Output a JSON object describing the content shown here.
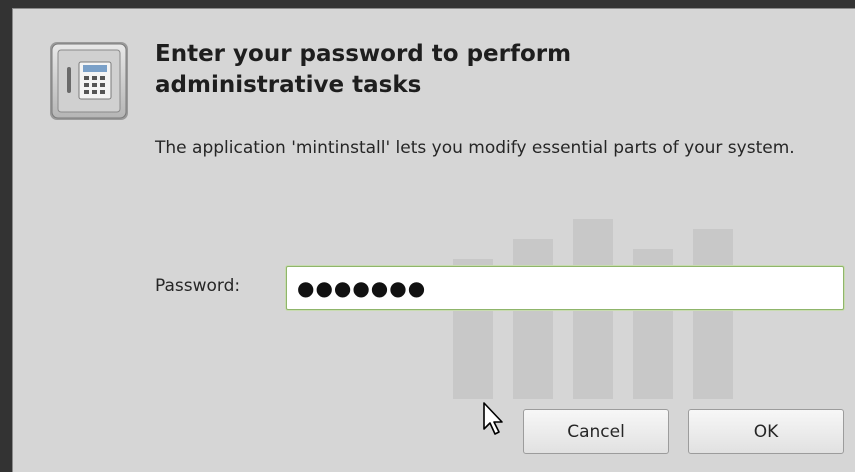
{
  "dialog": {
    "title": "Enter your password to perform administrative tasks",
    "description": "The application 'mintinstall' lets you modify essential parts of your system.",
    "password_label": "Password:",
    "password_value": "●●●●●●●",
    "cancel_label": "Cancel",
    "ok_label": "OK"
  },
  "icons": {
    "app_icon": "safe-keypad-icon",
    "cursor": "mouse-pointer-icon"
  },
  "colors": {
    "dialog_bg": "#d6d6d6",
    "input_focus_border": "#8fb56b"
  }
}
